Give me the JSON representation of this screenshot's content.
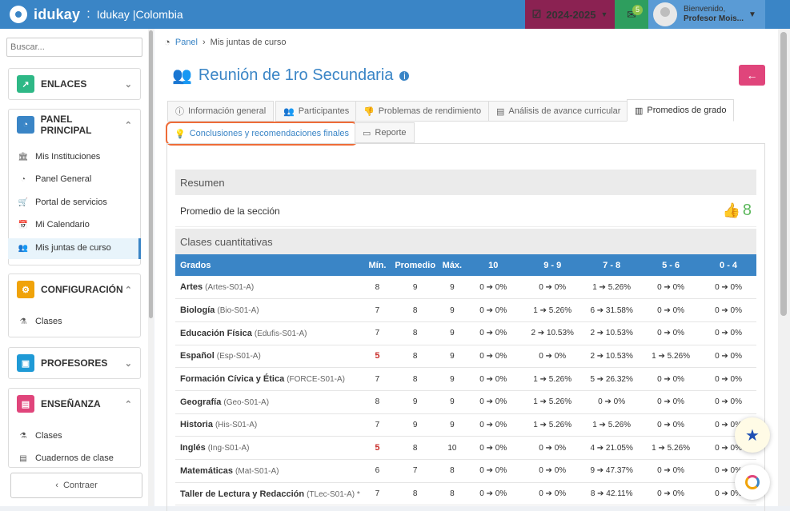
{
  "topbar": {
    "logo_text": "idukay",
    "separator": ":",
    "app_title": "Idukay |Colombia",
    "year_label": "2024-2025",
    "mail_count": "5",
    "greeting": "Bienvenido,",
    "user_name": "Profesor Mois..."
  },
  "sidebar": {
    "search_placeholder": "Buscar...",
    "sections": [
      {
        "label": "ENLACES",
        "color": "#2eb886"
      },
      {
        "label": "PANEL PRINCIPAL",
        "color": "#3a85c6"
      },
      {
        "label": "CONFIGURACIÓN",
        "color": "#f0a30a"
      },
      {
        "label": "PROFESORES",
        "color": "#1f9ad6"
      },
      {
        "label": "ENSEÑANZA",
        "color": "#e0457b"
      }
    ],
    "panel_items": [
      "Mis Instituciones",
      "Panel General",
      "Portal de servicios",
      "Mi Calendario",
      "Mis juntas de curso"
    ],
    "config_items": [
      "Clases"
    ],
    "ensenanza_items": [
      "Clases",
      "Cuadernos de clase"
    ],
    "collapse_label": "Contraer"
  },
  "breadcrumb": {
    "home": "Panel",
    "current": "Mis juntas de curso"
  },
  "page_title": "Reunión de 1ro Secundaria",
  "tabs": [
    "Información general",
    "Participantes",
    "Problemas de rendimiento",
    "Análisis de avance curricular",
    "Promedios de grado",
    "Conclusiones y recomendaciones finales",
    "Reporte"
  ],
  "summary": {
    "title": "Resumen",
    "avg_label": "Promedio de la sección",
    "avg_value": "8",
    "quant_title": "Clases cuantitativas"
  },
  "table": {
    "headers": [
      "Grados",
      "Mín.",
      "Promedio",
      "Máx.",
      "10",
      "9 - 9",
      "7 - 8",
      "5 - 6",
      "0 - 4"
    ],
    "rows": [
      {
        "name": "Artes",
        "code": "(Artes-S01-A)",
        "min": "8",
        "avg": "9",
        "max": "9",
        "b": [
          "0 ➔ 0%",
          "0 ➔ 0%",
          "1 ➔ 5.26%",
          "0 ➔ 0%",
          "0 ➔ 0%"
        ],
        "red": false
      },
      {
        "name": "Biología",
        "code": "(Bio-S01-A)",
        "min": "7",
        "avg": "8",
        "max": "9",
        "b": [
          "0 ➔ 0%",
          "1 ➔ 5.26%",
          "6 ➔ 31.58%",
          "0 ➔ 0%",
          "0 ➔ 0%"
        ],
        "red": false
      },
      {
        "name": "Educación Física",
        "code": "(Edufis-S01-A)",
        "min": "7",
        "avg": "8",
        "max": "9",
        "b": [
          "0 ➔ 0%",
          "2 ➔ 10.53%",
          "2 ➔ 10.53%",
          "0 ➔ 0%",
          "0 ➔ 0%"
        ],
        "red": false
      },
      {
        "name": "Español",
        "code": "(Esp-S01-A)",
        "min": "5",
        "avg": "8",
        "max": "9",
        "b": [
          "0 ➔ 0%",
          "0 ➔ 0%",
          "2 ➔ 10.53%",
          "1 ➔ 5.26%",
          "0 ➔ 0%"
        ],
        "red": true
      },
      {
        "name": "Formación Cívica y Ética",
        "code": "(FORCE-S01-A)",
        "min": "7",
        "avg": "8",
        "max": "9",
        "b": [
          "0 ➔ 0%",
          "1 ➔ 5.26%",
          "5 ➔ 26.32%",
          "0 ➔ 0%",
          "0 ➔ 0%"
        ],
        "red": false
      },
      {
        "name": "Geografía",
        "code": "(Geo-S01-A)",
        "min": "8",
        "avg": "9",
        "max": "9",
        "b": [
          "0 ➔ 0%",
          "1 ➔ 5.26%",
          "0 ➔ 0%",
          "0 ➔ 0%",
          "0 ➔ 0%"
        ],
        "red": false
      },
      {
        "name": "Historia",
        "code": "(His-S01-A)",
        "min": "7",
        "avg": "9",
        "max": "9",
        "b": [
          "0 ➔ 0%",
          "1 ➔ 5.26%",
          "1 ➔ 5.26%",
          "0 ➔ 0%",
          "0 ➔ 0%"
        ],
        "red": false
      },
      {
        "name": "Inglés",
        "code": "(Ing-S01-A)",
        "min": "5",
        "avg": "8",
        "max": "10",
        "b": [
          "0 ➔ 0%",
          "0 ➔ 0%",
          "4 ➔ 21.05%",
          "1 ➔ 5.26%",
          "0 ➔ 0%"
        ],
        "red": true
      },
      {
        "name": "Matemáticas",
        "code": "(Mat-S01-A)",
        "min": "6",
        "avg": "7",
        "max": "8",
        "b": [
          "0 ➔ 0%",
          "0 ➔ 0%",
          "9 ➔ 47.37%",
          "0 ➔ 0%",
          "0 ➔ 0%"
        ],
        "red": false
      },
      {
        "name": "Taller de Lectura y Redacción",
        "code": "(TLec-S01-A)  *",
        "min": "7",
        "avg": "8",
        "max": "8",
        "b": [
          "0 ➔ 0%",
          "0 ➔ 0%",
          "8 ➔ 42.11%",
          "0 ➔ 0%",
          "0 ➔ 0%"
        ],
        "red": false
      }
    ]
  },
  "colors": {
    "primary": "#3a85c6",
    "accent_pink": "#e0457b",
    "highlight": "#ee6c38",
    "success": "#5cb85c",
    "warning_red": "#c9302c"
  }
}
